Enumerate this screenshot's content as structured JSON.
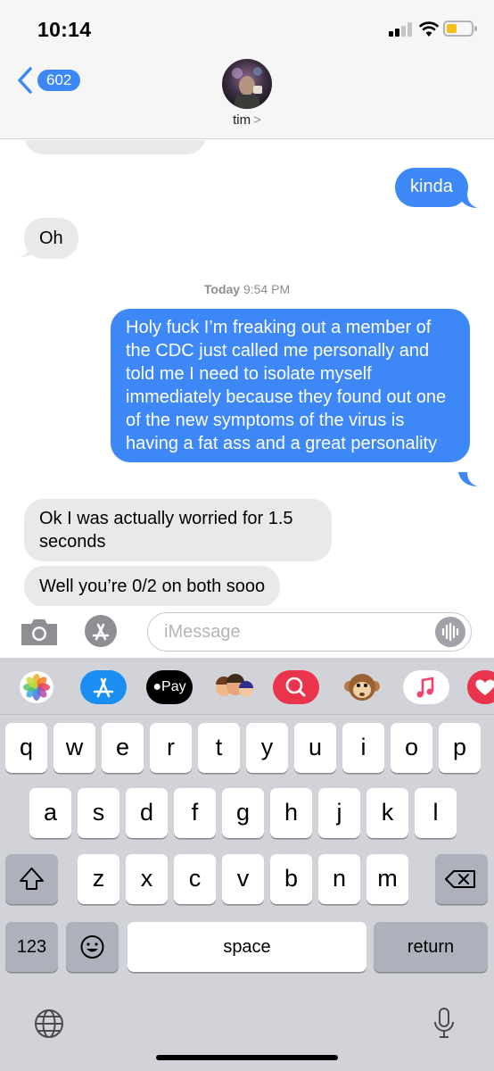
{
  "status_bar": {
    "time": "10:14",
    "battery_color": "#f3c019"
  },
  "header": {
    "back_count": "602",
    "contact_name": "tim",
    "name_chevron": ">"
  },
  "messages": [
    {
      "id": "m0",
      "side": "in",
      "text": ""
    },
    {
      "id": "m1",
      "side": "out",
      "text": "kinda"
    },
    {
      "id": "m2",
      "side": "in",
      "text": "Oh"
    },
    {
      "id": "m3",
      "side": "out",
      "text": "Holy fuck I’m freaking out a member of the CDC just called me personally and told me I need to isolate myself immediately because they found out one of the new symptoms of the virus is having a fat ass and a great personality"
    },
    {
      "id": "m4",
      "side": "in",
      "text": "Ok I was actually worried for 1.5 seconds"
    },
    {
      "id": "m5",
      "side": "in",
      "text": "Well you’re 0/2 on both sooo"
    }
  ],
  "timestamp": {
    "day": "Today",
    "time": "9:54 PM"
  },
  "compose": {
    "placeholder": "iMessage"
  },
  "app_drawer": [
    "photos-icon",
    "app-store-icon",
    "apple-pay-icon",
    "memoji-icon",
    "web-search-icon",
    "animoji-icon",
    "music-icon",
    "digital-touch-icon"
  ],
  "apple_pay_label": "Pay",
  "keyboard": {
    "row1": [
      "q",
      "w",
      "e",
      "r",
      "t",
      "y",
      "u",
      "i",
      "o",
      "p"
    ],
    "row2": [
      "a",
      "s",
      "d",
      "f",
      "g",
      "h",
      "j",
      "k",
      "l"
    ],
    "row3": [
      "z",
      "x",
      "c",
      "v",
      "b",
      "n",
      "m"
    ],
    "numbers": "123",
    "space": "space",
    "return": "return"
  },
  "colors": {
    "accent": "#3e87f6",
    "incoming": "#e9e9eb",
    "keyboard_bg": "#d1d3d9"
  }
}
